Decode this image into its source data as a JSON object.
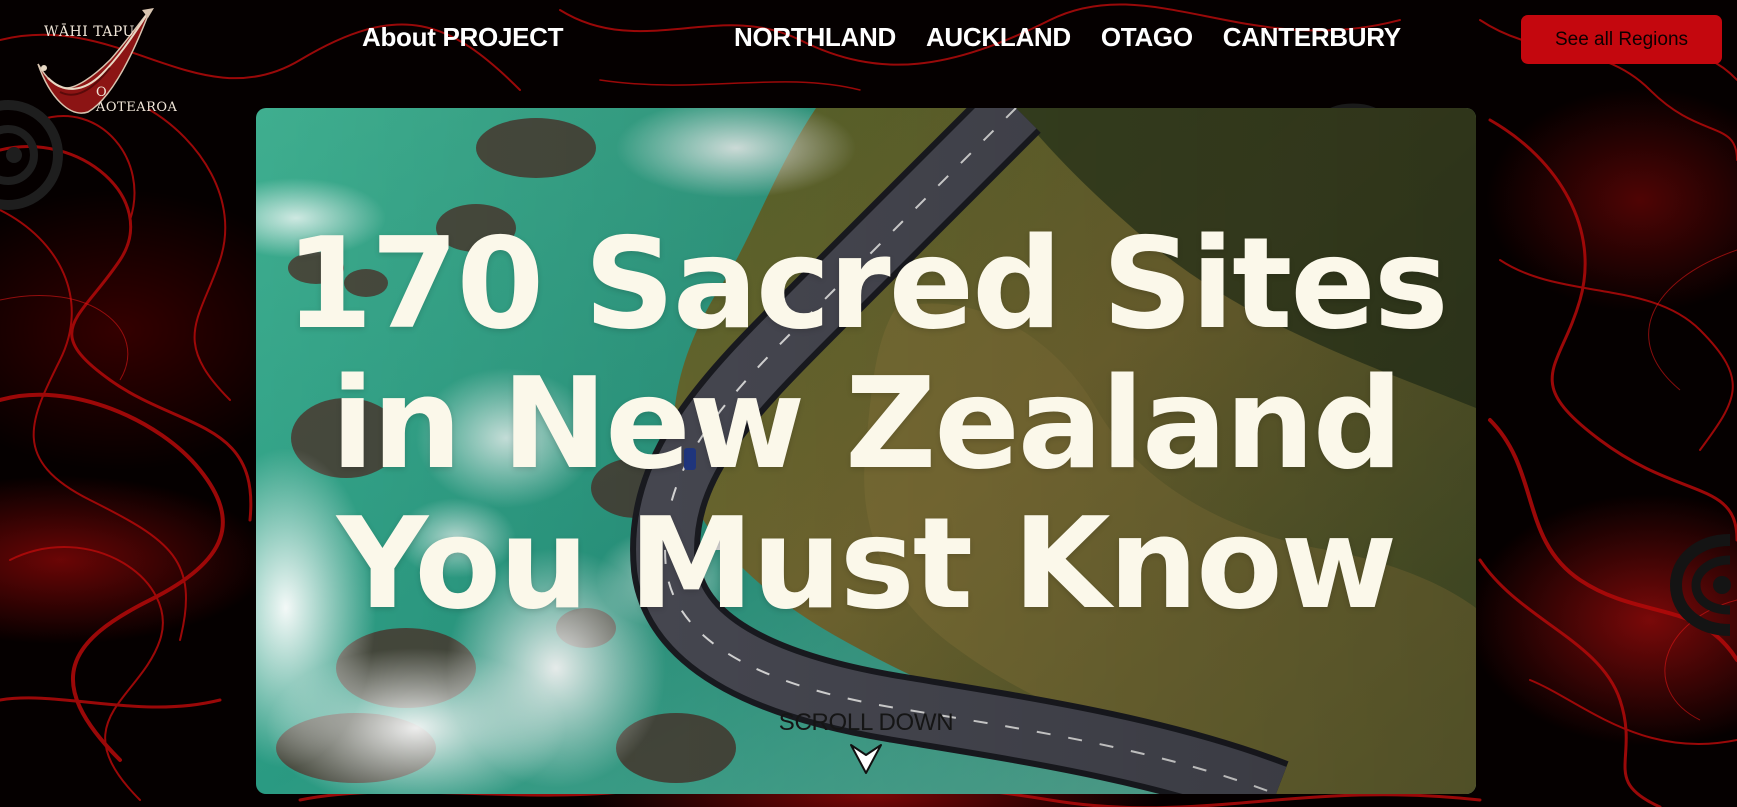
{
  "brand": {
    "logo_line1": "WĀHI TAPU",
    "logo_line2": "O AOTEAROA"
  },
  "nav": {
    "about": "About PROJECT",
    "regions": [
      "NORTHLAND",
      "AUCKLAND",
      "OTAGO",
      "CANTERBURY"
    ],
    "see_all": "See all Regions"
  },
  "hero": {
    "title_lines": [
      "170 Sacred Sites",
      "in New Zealand",
      "You Must Know"
    ],
    "scroll_label": "SCROLL DOWN"
  },
  "icons": {
    "scroll": "chevron-down-icon",
    "emblems": [
      "koru-emblem-icon"
    ]
  },
  "colors": {
    "accent": "#c4070e",
    "background": "#050000",
    "hero_text": "#fbf8ea"
  }
}
